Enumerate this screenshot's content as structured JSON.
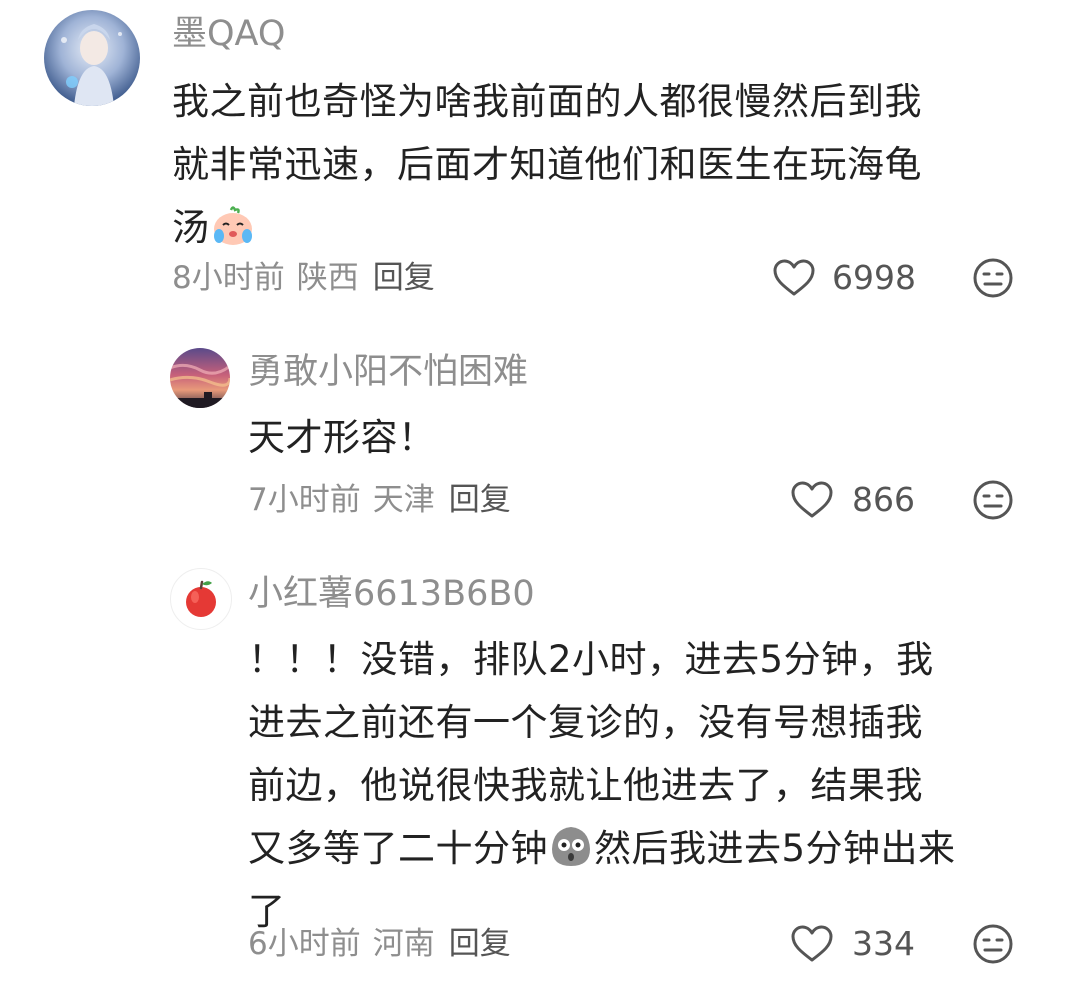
{
  "comments": [
    {
      "username": "墨QAQ",
      "body_before": "我之前也奇怪为啥我前面的人都很慢然后到我\n就非常迅速，后面才知道他们和医生在玩海龟\n汤",
      "body_after": "",
      "emoji": "crying-face-emoji",
      "time": "8小时前",
      "location": "陕西",
      "reply": "回复",
      "likes": "6998",
      "avatar": "ice-princess-avatar"
    },
    {
      "username": "勇敢小阳不怕困难",
      "body_before": "天才形容！",
      "body_after": "",
      "time": "7小时前",
      "location": "天津",
      "reply": "回复",
      "likes": "866",
      "avatar": "sunset-sky-avatar"
    },
    {
      "username": "小红薯6613B6B0",
      "body_before": "！！！没错，排队2小时，进去5分钟，我\n进去之前还有一个复诊的，没有号想插我\n前边，他说很快我就让他进去了，结果我\n又多等了二十分钟",
      "body_after": "然后我进去5分钟出来\n了",
      "emoji": "shocked-blob-emoji",
      "time": "6小时前",
      "location": "河南",
      "reply": "回复",
      "likes": "334",
      "avatar": "apple-avatar"
    }
  ],
  "colors": {
    "meta_text": "#8e8e8e",
    "body_text": "#222222",
    "icon_stroke": "#555555"
  }
}
